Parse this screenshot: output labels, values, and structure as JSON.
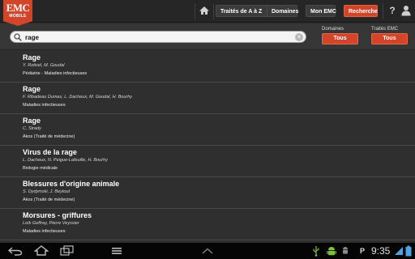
{
  "logo": {
    "line1": "EMC",
    "line2": "MOBILE"
  },
  "nav": {
    "items": [
      {
        "label": "Traités de A à Z"
      },
      {
        "label": "Domaines"
      },
      {
        "label": "Mon EMC"
      },
      {
        "label": "Recherche"
      }
    ],
    "help_glyph": "?"
  },
  "search": {
    "value": "rage",
    "placeholder": "",
    "clear_glyph": "×"
  },
  "filters": {
    "domaines": {
      "label": "Domaines",
      "value": "Tous"
    },
    "traites": {
      "label": "Traités EMC",
      "value": "Tous"
    }
  },
  "results": [
    {
      "title": "Rage",
      "authors": "Y. Rotivel, M. Goudal",
      "source": "Pédiatrie - Maladies infectieuses"
    },
    {
      "title": "Rage",
      "authors": "F. Ribadeau Dumas, L. Dacheux, M. Goudal, H. Bourhy",
      "source": "Maladies infectieuses"
    },
    {
      "title": "Rage",
      "authors": "C. Strady",
      "source": "Akos (Traité de médecine)"
    },
    {
      "title": "Virus de la rage",
      "authors": "L. Dacheux, N. Peigue-Lafeuille, H. Bourhy",
      "source": "Biologie médicale"
    },
    {
      "title": "Blessures d'origine animale",
      "authors": "S. Dydymski, J. Beytout",
      "source": "Akos (Traité de médecine)"
    },
    {
      "title": "Morsures - griffures",
      "authors": "Loïk Geffray, Pierre Veyssier",
      "source": "Maladies infectieuses"
    }
  ],
  "statusbar": {
    "time": "9:35",
    "p_glyph": "P"
  },
  "colors": {
    "accent": "#d2452b",
    "topbar": "#262626",
    "list_bg": "#2f2f2f",
    "system_bar": "#050505"
  },
  "icons": [
    "home-icon",
    "help-icon",
    "user-icon",
    "search-icon",
    "clear-icon",
    "back-icon",
    "android-home-icon",
    "recent-apps-icon",
    "menu-icon",
    "up-chevron-icon",
    "usb-icon",
    "android-robot-icon",
    "wifi-icon",
    "battery-icon"
  ]
}
